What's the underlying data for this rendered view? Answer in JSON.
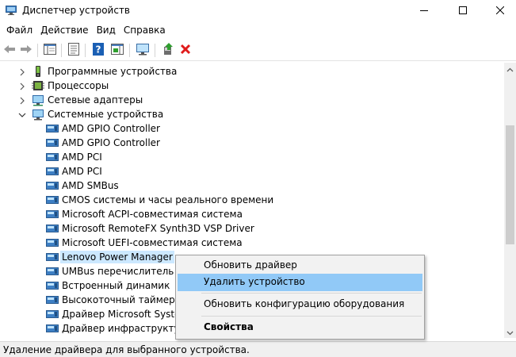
{
  "window": {
    "title": "Диспетчер устройств",
    "icon": "device-manager-icon",
    "controls": [
      "minimize-icon",
      "maximize-icon",
      "close-icon"
    ]
  },
  "menubar": {
    "items": [
      "Файл",
      "Действие",
      "Вид",
      "Справка"
    ]
  },
  "toolbar": {
    "buttons": [
      "back-arrow-icon",
      "forward-arrow-icon",
      "show-hide-tree-icon",
      "properties-icon",
      "help-icon",
      "action-pane-icon",
      "scan-hardware-icon",
      "update-driver-icon",
      "uninstall-icon"
    ]
  },
  "tree": {
    "categories": [
      {
        "label": "Программные устройства",
        "icon": "software-device-icon",
        "expanded": false
      },
      {
        "label": "Процессоры",
        "icon": "processor-icon",
        "expanded": false
      },
      {
        "label": "Сетевые адаптеры",
        "icon": "network-adapter-icon",
        "expanded": false
      },
      {
        "label": "Системные устройства",
        "icon": "system-device-icon",
        "expanded": true
      }
    ],
    "devices": [
      "AMD GPIO Controller",
      "AMD GPIO Controller",
      "AMD PCI",
      "AMD PCI",
      "AMD SMBus",
      "CMOS системы и часы реального времени",
      "Microsoft ACPI-совместимая система",
      "Microsoft RemoteFX Synth3D VSP Driver",
      "Microsoft UEFI-совместимая система",
      "Lenovo Power Manager",
      "UMBus перечислитель ко",
      "Встроенный динамик",
      "Высокоточный таймер со",
      "Драйвер Microsoft System",
      "Драйвер инфраструктуры"
    ],
    "selected_device": "Lenovo Power Manager"
  },
  "context_menu": {
    "update_driver": "Обновить драйвер",
    "uninstall_device": "Удалить устройство",
    "scan_hardware": "Обновить конфигурацию оборудования",
    "properties": "Свойства",
    "highlighted": "Удалить устройство"
  },
  "statusbar": {
    "text": "Удаление драйвера для выбранного устройства."
  },
  "colors": {
    "selection": "#cce8ff",
    "menu_highlight": "#91c9f7",
    "uninstall_red": "#e01b1b",
    "update_green": "#2e9e2e",
    "help_blue": "#1a5fb4"
  }
}
